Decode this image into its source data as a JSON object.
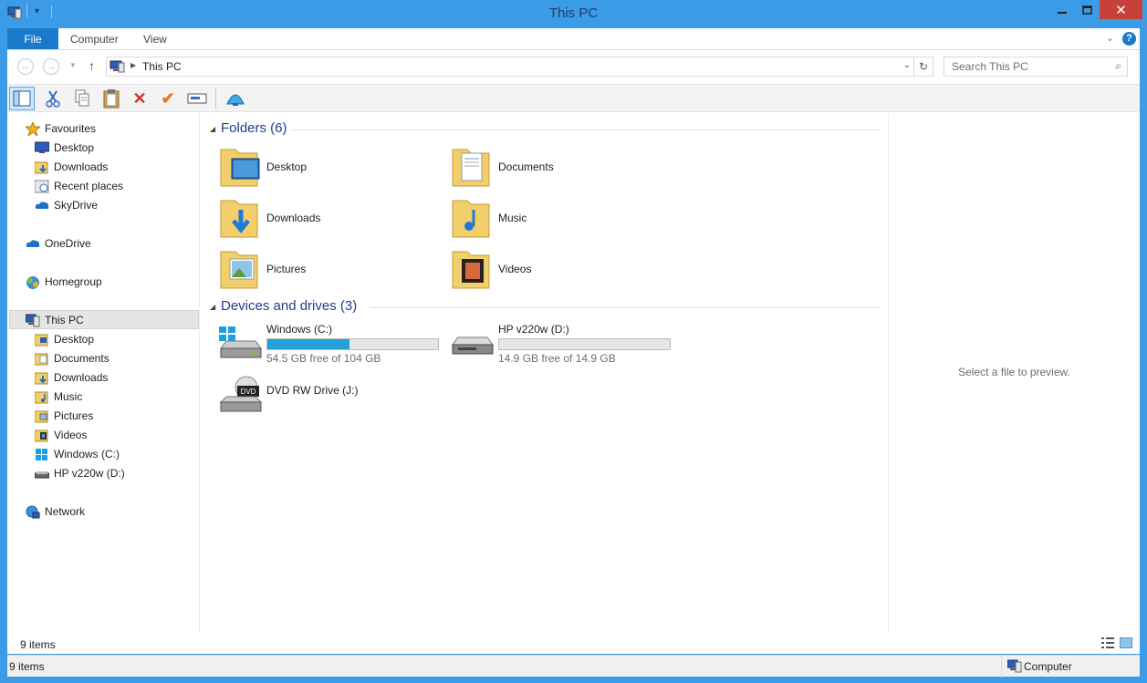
{
  "window": {
    "title": "This PC"
  },
  "ribbon": {
    "tabs": [
      "File",
      "Computer",
      "View"
    ]
  },
  "address": {
    "path": "This PC",
    "search_placeholder": "Search This PC"
  },
  "nav": {
    "favourites": "Favourites",
    "fav_items": [
      "Desktop",
      "Downloads",
      "Recent places",
      "SkyDrive"
    ],
    "onedrive": "OneDrive",
    "homegroup": "Homegroup",
    "thispc": "This PC",
    "pc_items": [
      "Desktop",
      "Documents",
      "Downloads",
      "Music",
      "Pictures",
      "Videos",
      "Windows (C:)",
      "HP v220w (D:)"
    ],
    "network": "Network"
  },
  "main": {
    "folders_header": "Folders (6)",
    "folders": [
      "Desktop",
      "Documents",
      "Downloads",
      "Music",
      "Pictures",
      "Videos"
    ],
    "devices_header": "Devices and drives (3)",
    "drives": [
      {
        "name": "Windows (C:)",
        "free": "54.5 GB free of 104 GB",
        "used_fraction": 0.48
      },
      {
        "name": "HP v220w (D:)",
        "free": "14.9 GB free of 14.9 GB",
        "used_fraction": 0.0
      },
      {
        "name": "DVD RW Drive (J:)"
      }
    ]
  },
  "preview": {
    "text": "Select a file to preview."
  },
  "status": {
    "items": "9 items",
    "bottom_items": "9 items",
    "zone": "Computer"
  }
}
